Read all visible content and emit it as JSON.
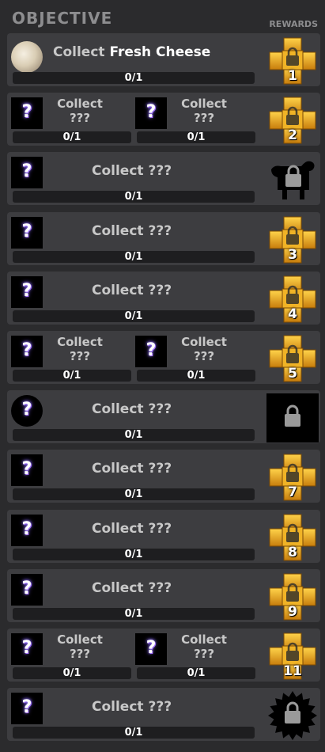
{
  "header": {
    "title": "OBJECTIVE",
    "rewards": "REWARDS"
  },
  "collect_word": "Collect",
  "unknown": "???",
  "progress": "0/1",
  "rows": [
    {
      "type": "single",
      "name": "Fresh Cheese",
      "reward": "cube",
      "num": "1"
    },
    {
      "type": "double",
      "reward": "cube",
      "num": "2"
    },
    {
      "type": "single",
      "name": "???",
      "reward": "cow"
    },
    {
      "type": "single",
      "name": "???",
      "reward": "cube",
      "num": "3"
    },
    {
      "type": "single",
      "name": "???",
      "reward": "cube",
      "num": "4"
    },
    {
      "type": "double",
      "reward": "cube",
      "num": "5"
    },
    {
      "type": "single",
      "name": "???",
      "reward": "box",
      "circle": true
    },
    {
      "type": "single",
      "name": "???",
      "reward": "cube",
      "num": "7"
    },
    {
      "type": "single",
      "name": "???",
      "reward": "cube",
      "num": "8"
    },
    {
      "type": "single",
      "name": "???",
      "reward": "cube",
      "num": "9"
    },
    {
      "type": "double",
      "reward": "cube",
      "num": "11"
    },
    {
      "type": "single",
      "name": "???",
      "reward": "badge"
    }
  ],
  "colors": {
    "gold": "#e8a21a",
    "panel": "#3d3d40",
    "bg": "#2b2b2d"
  }
}
